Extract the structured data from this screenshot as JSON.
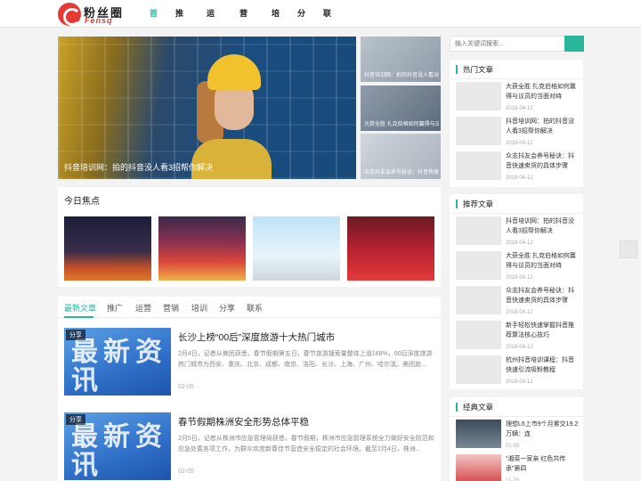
{
  "logo": {
    "cn": "粉丝圈",
    "en": "Fensq"
  },
  "nav": [
    {
      "label": "首页",
      "active": true
    },
    {
      "label": "推广",
      "active": false
    },
    {
      "label": "运营",
      "active": false
    },
    {
      "label": "营销",
      "active": false
    },
    {
      "label": "培训",
      "active": false
    },
    {
      "label": "分享",
      "active": false
    },
    {
      "label": "联系",
      "active": false
    }
  ],
  "hero": {
    "caption": "抖音培训网：拍的抖音没人看3招帮你解决"
  },
  "side_thumbs": [
    "抖音培训网：拍的抖音没人看3招帮你解决",
    "大获全胜 扎克伯格如何赢得与议员的当面对峙",
    "众志抖友会养号秘诀：抖音快速卖货的具体步骤"
  ],
  "focus": {
    "title": "今日焦点"
  },
  "news_tabs": [
    "最新文章",
    "推广",
    "运营",
    "营销",
    "培训",
    "分享",
    "联系"
  ],
  "articles": [
    {
      "tag": "分享",
      "image_text": "最新资讯",
      "title": "长沙上榜“00后”深度旅游十大热门城市",
      "desc": "2月4日，记者从美团获悉，春节假期第五日，春节旅游搜索量整体上涨168%，00后深度旅游热门城市为西安、重庆、北京、成都、南京、洛阳、长沙、上海、广州、哈尔滨。美团旅...",
      "date": "02-05"
    },
    {
      "tag": "分享",
      "image_text": "最新资讯",
      "title": "春节假期株洲安全形势总体平稳",
      "desc": "2月5日，记者从株洲市应急管理局获悉，春节假期，株洲市应急管理系统全力做好安全防范和应急处置各项工作，为群众欢度新春佳节营造安全稳定的社会环境。截至2月4日，株洲...",
      "date": "02-05"
    }
  ],
  "search": {
    "placeholder": "输入关键词搜索..."
  },
  "hot": {
    "title": "热门文章",
    "items": [
      {
        "text": "大获全胜 扎克伯格如何赢得与议员的当面对峙",
        "date": "2018-04-12"
      },
      {
        "text": "抖音培训网：拍的抖音没人看3招帮你解决",
        "date": "2018-04-12"
      },
      {
        "text": "众志抖友会养号秘诀：抖音快速卖货的具体步骤",
        "date": "2018-04-12"
      }
    ]
  },
  "recommend": {
    "title": "推荐文章",
    "items": [
      {
        "text": "抖音培训网：拍的抖音没人看3招帮你解决",
        "date": "2018-04-12"
      },
      {
        "text": "大获全胜 扎克伯格如何赢得与议员的当面对峙",
        "date": "2018-04-12"
      },
      {
        "text": "众志抖友会养号秘诀：抖音快速卖货的具体步骤",
        "date": "2018-04-12"
      },
      {
        "text": "新手轻松快速掌握抖音推荐算法核心技巧",
        "date": "2018-04-12"
      },
      {
        "text": "杭州抖音培训课程：抖音快速引流吸粉教程",
        "date": "2018-04-12"
      }
    ]
  },
  "classic": {
    "title": "经典文章",
    "items": [
      {
        "text": "理想L6上市9个月累交19.2万辆：连",
        "date": "01-03"
      },
      {
        "text": "“湘菜一家亲 红色共传承”第四",
        "date": "11-29"
      }
    ]
  }
}
